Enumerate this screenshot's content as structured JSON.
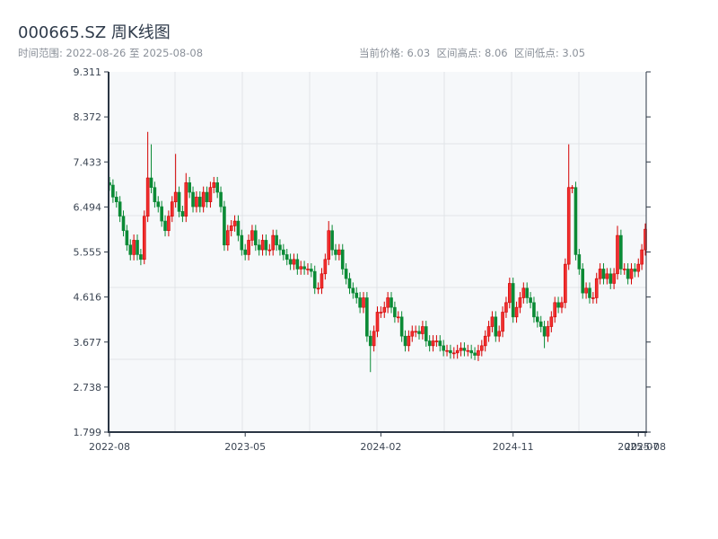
{
  "header": {
    "title": "000665.SZ 周K线图",
    "range": "时间范围: 2022-08-26 至 2025-08-08",
    "stats": "当前价格: 6.03  区间高点: 8.06  区间低点: 3.05"
  },
  "chart_data": {
    "type": "candlestick",
    "title": "000665.SZ 周K线图",
    "interval": "weekly",
    "start": "2022-08-26",
    "end": "2025-08-08",
    "ylim": [
      1.799,
      9.311
    ],
    "y_ticks": [
      "9.311",
      "8.372",
      "7.433",
      "6.494",
      "5.555",
      "4.616",
      "3.677",
      "2.738",
      "1.799"
    ],
    "x_ticks": [
      {
        "label": "2022-08",
        "index": 0
      },
      {
        "label": "2023-05",
        "index": 39
      },
      {
        "label": "2024-02",
        "index": 78
      },
      {
        "label": "2024-11",
        "index": 116
      },
      {
        "label": "2025-07",
        "index": 152
      },
      {
        "label": "2025-08",
        "index": 154
      }
    ],
    "up_color": "#d40000",
    "down_color": "#0a8a35",
    "first_open": 7.0,
    "wick_pad": 0.12,
    "closes": [
      6.95,
      6.7,
      6.6,
      6.3,
      6.0,
      5.7,
      5.5,
      5.8,
      5.5,
      5.4,
      6.3,
      7.1,
      6.9,
      6.6,
      6.5,
      6.2,
      6.0,
      6.3,
      6.6,
      6.8,
      6.4,
      6.3,
      7.0,
      6.8,
      6.5,
      6.7,
      6.5,
      6.8,
      6.6,
      6.9,
      7.0,
      6.8,
      6.5,
      5.7,
      6.0,
      6.1,
      6.2,
      5.9,
      5.6,
      5.5,
      5.8,
      6.0,
      5.7,
      5.6,
      5.8,
      5.6,
      5.6,
      5.9,
      5.7,
      5.6,
      5.5,
      5.4,
      5.3,
      5.4,
      5.2,
      5.25,
      5.2,
      5.2,
      5.15,
      4.8,
      4.8,
      5.1,
      5.4,
      6.0,
      5.6,
      5.5,
      5.6,
      5.2,
      5.0,
      4.8,
      4.7,
      4.6,
      4.4,
      4.6,
      3.8,
      3.6,
      3.9,
      4.3,
      4.3,
      4.4,
      4.6,
      4.4,
      4.2,
      4.2,
      3.8,
      3.6,
      3.8,
      3.9,
      3.9,
      3.85,
      4.0,
      3.7,
      3.6,
      3.7,
      3.7,
      3.6,
      3.5,
      3.5,
      3.45,
      3.45,
      3.5,
      3.55,
      3.5,
      3.5,
      3.45,
      3.4,
      3.5,
      3.6,
      3.8,
      4.0,
      4.2,
      3.8,
      3.9,
      4.3,
      4.5,
      4.9,
      4.2,
      4.4,
      4.6,
      4.8,
      4.6,
      4.5,
      4.2,
      4.1,
      4.0,
      3.8,
      4.0,
      4.2,
      4.5,
      4.4,
      4.5,
      5.3,
      6.9,
      6.9,
      5.5,
      5.2,
      4.7,
      4.8,
      4.6,
      4.6,
      5.0,
      5.2,
      5.0,
      5.1,
      4.9,
      5.1,
      5.9,
      5.2,
      5.2,
      5.0,
      5.2,
      5.15,
      5.3,
      5.6,
      6.03
    ],
    "high_overrides": {
      "11": 8.06,
      "12": 7.8,
      "19": 7.6,
      "22": 7.2,
      "63": 6.2,
      "132": 7.8,
      "133": 6.95,
      "146": 6.1
    },
    "low_overrides": {
      "75": 3.05,
      "10": 5.3,
      "105": 3.3,
      "125": 3.55
    }
  }
}
